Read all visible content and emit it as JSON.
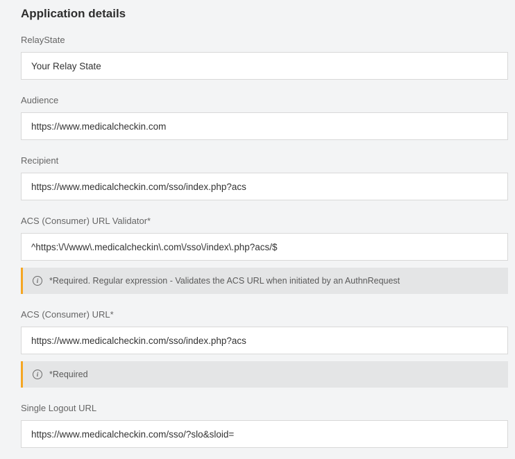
{
  "section_title": "Application details",
  "fields": {
    "relay_state": {
      "label": "RelayState",
      "value": "Your Relay State"
    },
    "audience": {
      "label": "Audience",
      "value": "https://www.medicalcheckin.com"
    },
    "recipient": {
      "label": "Recipient",
      "value": "https://www.medicalcheckin.com/sso/index.php?acs"
    },
    "acs_validator": {
      "label": "ACS (Consumer) URL Validator*",
      "value": "^https:\\/\\/www\\.medicalcheckin\\.com\\/sso\\/index\\.php?acs/$",
      "helper": "*Required. Regular expression - Validates the ACS URL when initiated by an AuthnRequest"
    },
    "acs_url": {
      "label": "ACS (Consumer) URL*",
      "value": "https://www.medicalcheckin.com/sso/index.php?acs",
      "helper": "*Required"
    },
    "single_logout": {
      "label": "Single Logout URL",
      "value": "https://www.medicalcheckin.com/sso/?slo&sloid="
    }
  }
}
